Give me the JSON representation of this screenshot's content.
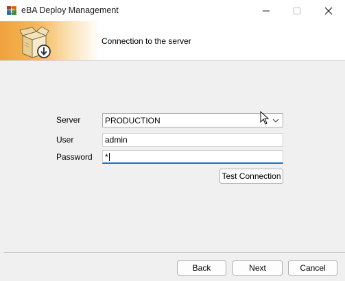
{
  "window": {
    "title": "eBA Deploy Management",
    "app_icon": "app-windows-icon"
  },
  "title_buttons": {
    "minimize_icon": "minimize-icon",
    "maximize_icon": "maximize-icon",
    "close_icon": "close-icon"
  },
  "header": {
    "icon": "package-download-icon",
    "title": "Connection to the server"
  },
  "form": {
    "server_label": "Server",
    "server_value": "PRODUCTION",
    "user_label": "User",
    "user_value": "admin",
    "password_label": "Password",
    "password_value": "*",
    "test_connection_label": "Test Connection"
  },
  "footer": {
    "back_label": "Back",
    "next_label": "Next",
    "cancel_label": "Cancel"
  },
  "colors": {
    "banner_accent": "#f0a23c",
    "focus_underline": "#1a6fc4",
    "window_bg": "#f0f0f0"
  }
}
